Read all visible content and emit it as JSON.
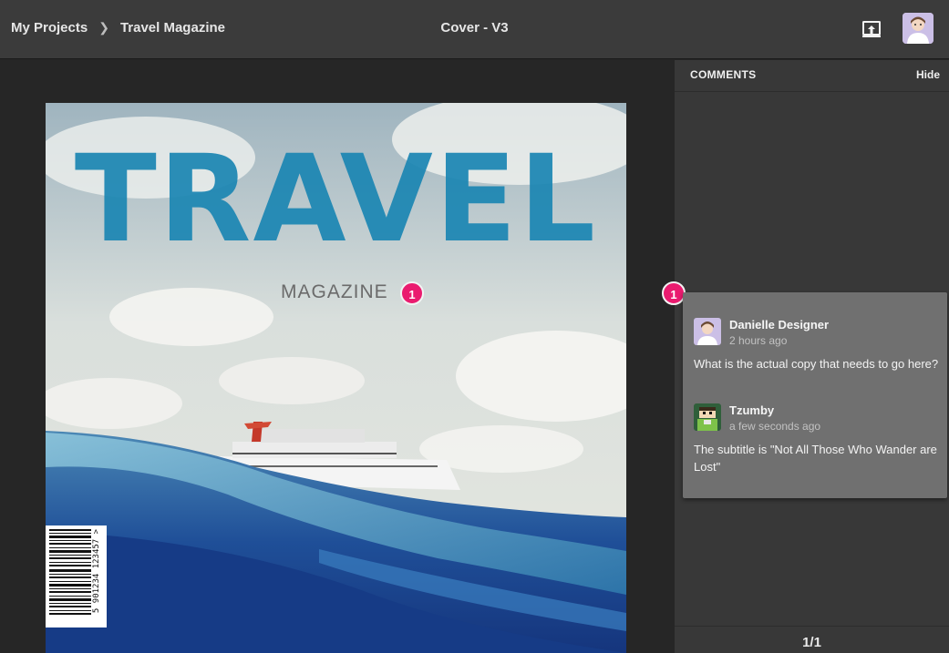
{
  "header": {
    "breadcrumb": [
      "My Projects",
      "Travel Magazine"
    ],
    "document_title": "Cover - V3",
    "share_icon": "share-upload-icon",
    "user_avatar": "user-avatar"
  },
  "cover": {
    "title": "TRAVEL",
    "subtitle": "MAGAZINE",
    "pin_number": "1",
    "title_color": "#1b86b3",
    "barcode_text": "5 901234 123457 >"
  },
  "comments_panel": {
    "title": "COMMENTS",
    "hide_label": "Hide",
    "thread_pin": "1",
    "comments": [
      {
        "author": "Danielle Designer",
        "time": "2 hours ago",
        "text": "What is the actual copy that needs to go here?"
      },
      {
        "author": "Tzumby",
        "time": "a few seconds ago",
        "text": "The subtitle is \"Not All Those Who Wander are Lost\""
      }
    ],
    "page_counter": "1/1"
  },
  "colors": {
    "pin": "#ea1b6f",
    "topbar": "#3b3b3b",
    "panel": "#383838",
    "thread": "#707070"
  }
}
